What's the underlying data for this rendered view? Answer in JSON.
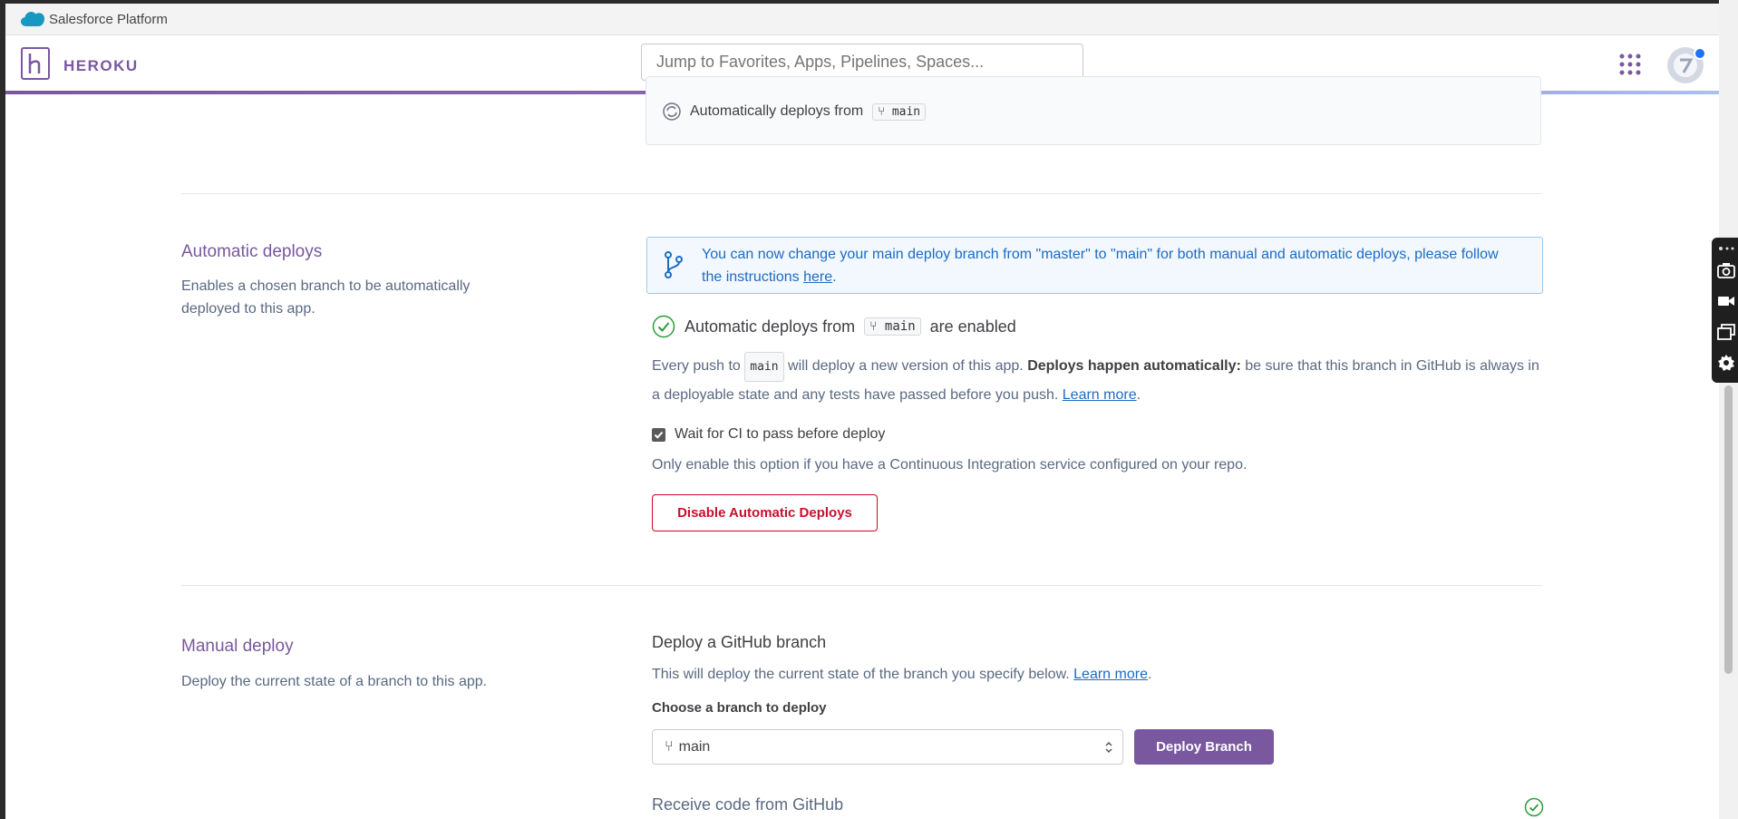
{
  "browser": {
    "platform_title": "Salesforce Platform"
  },
  "header": {
    "brand": "HEROKU",
    "search_placeholder": "Jump to Favorites, Apps, Pipelines, Spaces..."
  },
  "top_card": {
    "auto_deploy_text": "Automatically deploys from",
    "branch": "main"
  },
  "automatic_deploys": {
    "title": "Automatic deploys",
    "description": "Enables a chosen branch to be automatically deployed to this app.",
    "info_text_1": "You can now change your main deploy branch from \"master\" to \"main\" for both manual and automatic deploys, please follow the instructions ",
    "info_link": "here",
    "info_text_2": ".",
    "status_prefix": "Automatic deploys from",
    "status_branch": "main",
    "status_suffix": "are enabled",
    "para_1": "Every push to",
    "para_branch": "main",
    "para_2": "will deploy a new version of this app.",
    "para_bold": "Deploys happen automatically:",
    "para_3": "be sure that this branch in GitHub is always in a deployable state and any tests have passed before you push.",
    "para_link": "Learn more",
    "para_end": ".",
    "ci_label": "Wait for CI to pass before deploy",
    "ci_checked": true,
    "ci_note": "Only enable this option if you have a Continuous Integration service configured on your repo.",
    "disable_button": "Disable Automatic Deploys"
  },
  "manual_deploy": {
    "title": "Manual deploy",
    "description": "Deploy the current state of a branch to this app.",
    "heading": "Deploy a GitHub branch",
    "desc_text": "This will deploy the current state of the branch you specify below.",
    "desc_link": "Learn more",
    "desc_end": ".",
    "choose_label": "Choose a branch to deploy",
    "selected_branch": "main",
    "deploy_button": "Deploy Branch",
    "receive_code": "Receive code from GitHub"
  },
  "colors": {
    "brand": "#79589f",
    "link": "#1e6bc4",
    "danger": "#c8102e",
    "success": "#2a9d3a"
  }
}
